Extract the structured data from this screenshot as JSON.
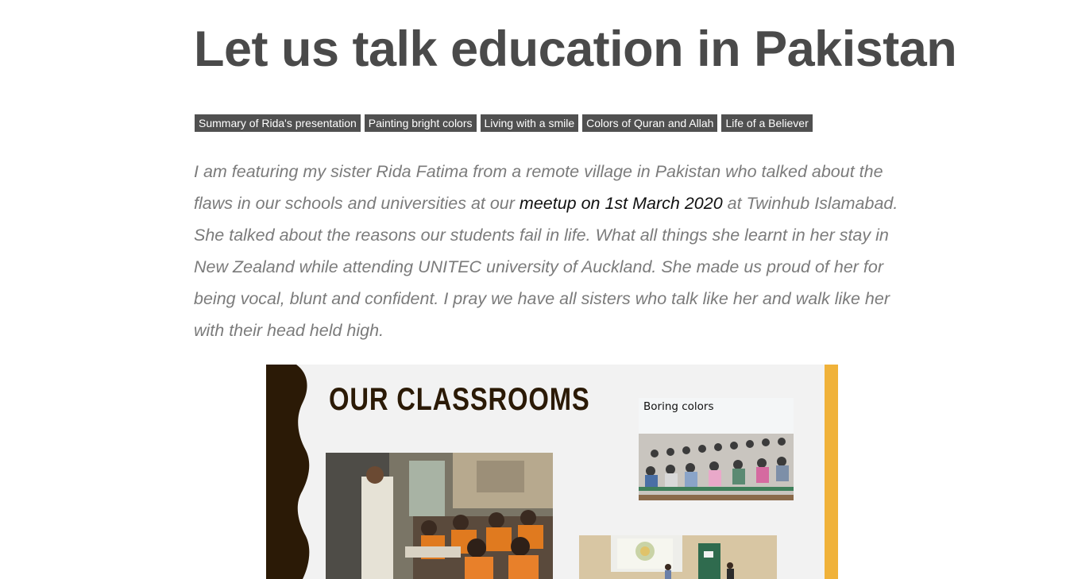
{
  "article": {
    "title": "Let us talk education in Pakistan",
    "tags": [
      "Summary of Rida's presentation",
      "Painting bright colors",
      "Living with a smile",
      "Colors of Quran and Allah",
      "Life of a Believer"
    ],
    "intro": {
      "before_link": "I am featuring my sister Rida Fatima from a remote village in Pakistan who talked about the flaws in our schools and universities at our ",
      "link_text": "meetup on 1st March 2020",
      "after_link": " at Twinhub Islamabad. She talked about the reasons our students fail in life. What all things she learnt in her stay in New Zealand while attending UNITEC university of Auckland. She made us proud of her for being vocal, blunt and confident. I pray we have all sisters who talk like her and walk like her with their head held high."
    }
  },
  "slide": {
    "heading": "OUR CLASSROOMS",
    "photo_caption": "Boring colors",
    "colors": {
      "background": "#f2f2f2",
      "wave": "#2b1a06",
      "accent_bar": "#f0b23a",
      "heading": "#2b1a06"
    }
  },
  "colors": {
    "title": "#4a4a4a",
    "tag_bg": "#505050",
    "tag_text": "#ffffff",
    "intro_text": "#7b7b7b",
    "link": "#111111"
  }
}
